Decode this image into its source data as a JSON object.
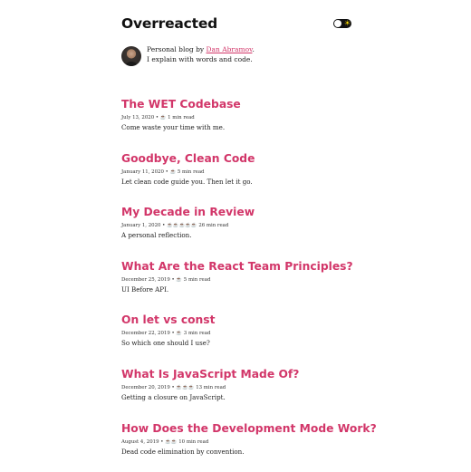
{
  "header": {
    "title": "Overreacted",
    "toggle_icon": "sun-icon"
  },
  "bio": {
    "line1_prefix": "Personal blog by ",
    "author_link": "Dan Abramov",
    "line1_suffix": ".",
    "line2": "I explain with words and code."
  },
  "posts": [
    {
      "title": "The WET Codebase",
      "meta": "July 13, 2020 • ☕️ 1 min read",
      "description": "Come waste your time with me."
    },
    {
      "title": "Goodbye, Clean Code",
      "meta": "January 11, 2020 • ☕️ 5 min read",
      "description": "Let clean code guide you. Then let it go."
    },
    {
      "title": "My Decade in Review",
      "meta": "January 1, 2020 • ☕️☕️☕️☕️☕️ 26 min read",
      "description": "A personal reflection."
    },
    {
      "title": "What Are the React Team Principles?",
      "meta": "December 25, 2019 • ☕️ 5 min read",
      "description": "UI Before API."
    },
    {
      "title": "On let vs const",
      "meta": "December 22, 2019 • ☕️ 3 min read",
      "description": "So which one should I use?"
    },
    {
      "title": "What Is JavaScript Made Of?",
      "meta": "December 20, 2019 • ☕️☕️☕️ 13 min read",
      "description": "Getting a closure on JavaScript."
    },
    {
      "title": "How Does the Development Mode Work?",
      "meta": "August 4, 2019 • ☕️☕️ 10 min read",
      "description": "Dead code elimination by convention."
    }
  ]
}
